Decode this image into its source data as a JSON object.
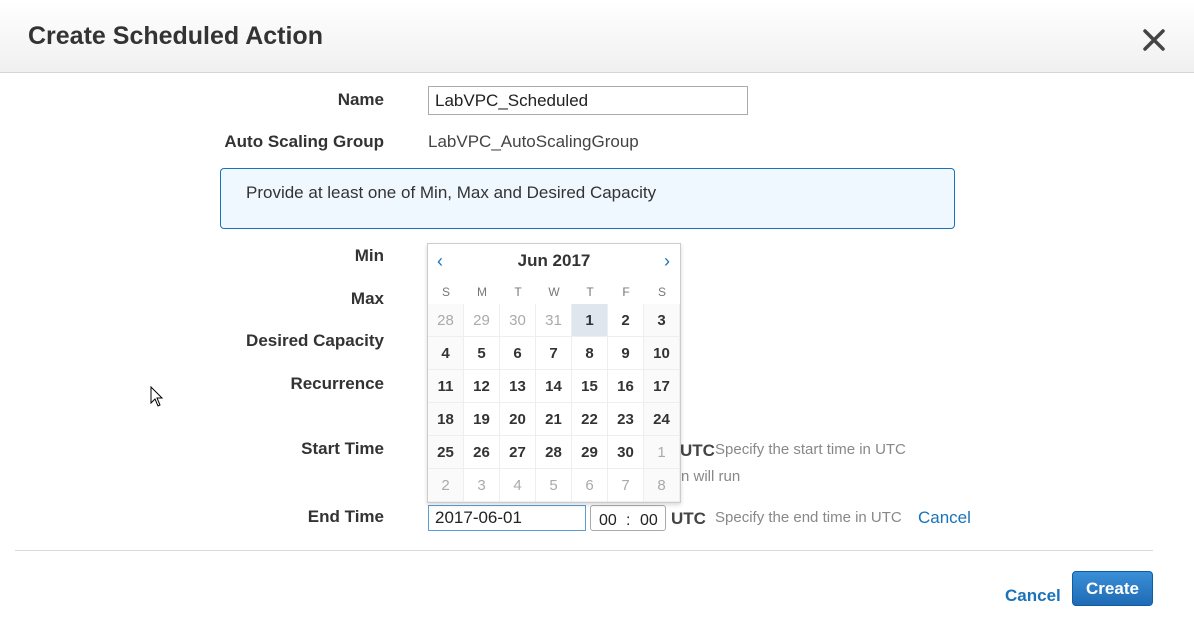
{
  "dialog": {
    "title": "Create Scheduled Action"
  },
  "form": {
    "name_label": "Name",
    "name_value": "LabVPC_Scheduled",
    "asg_label": "Auto Scaling Group",
    "asg_value": "LabVPC_AutoScalingGroup",
    "info_text": "Provide at least one of Min, Max and Desired Capacity",
    "min_label": "Min",
    "max_label": "Max",
    "desired_label": "Desired Capacity",
    "recurrence_label": "Recurrence",
    "start_label": "Start Time",
    "start_utc": "UTC",
    "start_hint": "Specify the start time in UTC",
    "recurrence_hint_partial": "n will run",
    "end_label": "End Time",
    "end_date": "2017-06-01",
    "end_hour": "00",
    "end_minute": "00",
    "time_separator": ":",
    "end_utc": "UTC",
    "end_hint": "Specify the end time in UTC",
    "end_cancel": "Cancel"
  },
  "calendar": {
    "month_label": "Jun 2017",
    "prev": "‹",
    "next": "›",
    "weekdays": [
      "S",
      "M",
      "T",
      "W",
      "T",
      "F",
      "S"
    ],
    "selected_day": "1",
    "weeks": [
      [
        {
          "d": "28",
          "o": true
        },
        {
          "d": "29",
          "o": true
        },
        {
          "d": "30",
          "o": true
        },
        {
          "d": "31",
          "o": true
        },
        {
          "d": "1",
          "o": false,
          "s": true
        },
        {
          "d": "2",
          "o": false
        },
        {
          "d": "3",
          "o": false
        }
      ],
      [
        {
          "d": "4"
        },
        {
          "d": "5"
        },
        {
          "d": "6"
        },
        {
          "d": "7"
        },
        {
          "d": "8"
        },
        {
          "d": "9"
        },
        {
          "d": "10"
        }
      ],
      [
        {
          "d": "11"
        },
        {
          "d": "12"
        },
        {
          "d": "13"
        },
        {
          "d": "14"
        },
        {
          "d": "15"
        },
        {
          "d": "16"
        },
        {
          "d": "17"
        }
      ],
      [
        {
          "d": "18"
        },
        {
          "d": "19"
        },
        {
          "d": "20"
        },
        {
          "d": "21"
        },
        {
          "d": "22"
        },
        {
          "d": "23"
        },
        {
          "d": "24"
        }
      ],
      [
        {
          "d": "25"
        },
        {
          "d": "26"
        },
        {
          "d": "27"
        },
        {
          "d": "28"
        },
        {
          "d": "29"
        },
        {
          "d": "30"
        },
        {
          "d": "1",
          "o": true
        }
      ],
      [
        {
          "d": "2",
          "o": true
        },
        {
          "d": "3",
          "o": true
        },
        {
          "d": "4",
          "o": true
        },
        {
          "d": "5",
          "o": true
        },
        {
          "d": "6",
          "o": true
        },
        {
          "d": "7",
          "o": true
        },
        {
          "d": "8",
          "o": true
        }
      ]
    ]
  },
  "footer": {
    "cancel": "Cancel",
    "create": "Create"
  },
  "icons": {
    "close": "close-icon",
    "cursor": "mouse-pointer-icon"
  }
}
